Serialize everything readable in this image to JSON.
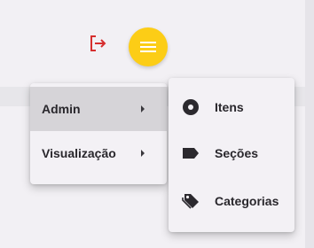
{
  "toolbar": {
    "logout_icon": "logout-icon",
    "logout_color": "#d62e2e",
    "menu_icon": "hamburger-menu-icon",
    "menu_color": "#fccd16"
  },
  "menu": {
    "items": [
      {
        "label": "Admin",
        "icon": "chevron-right-icon",
        "active": true
      },
      {
        "label": "Visualização",
        "icon": "chevron-right-icon",
        "active": false
      }
    ]
  },
  "submenu": {
    "items": [
      {
        "label": "Itens",
        "icon": "disc-icon"
      },
      {
        "label": "Seções",
        "icon": "label-icon"
      },
      {
        "label": "Categorias",
        "icon": "tags-icon"
      }
    ]
  }
}
